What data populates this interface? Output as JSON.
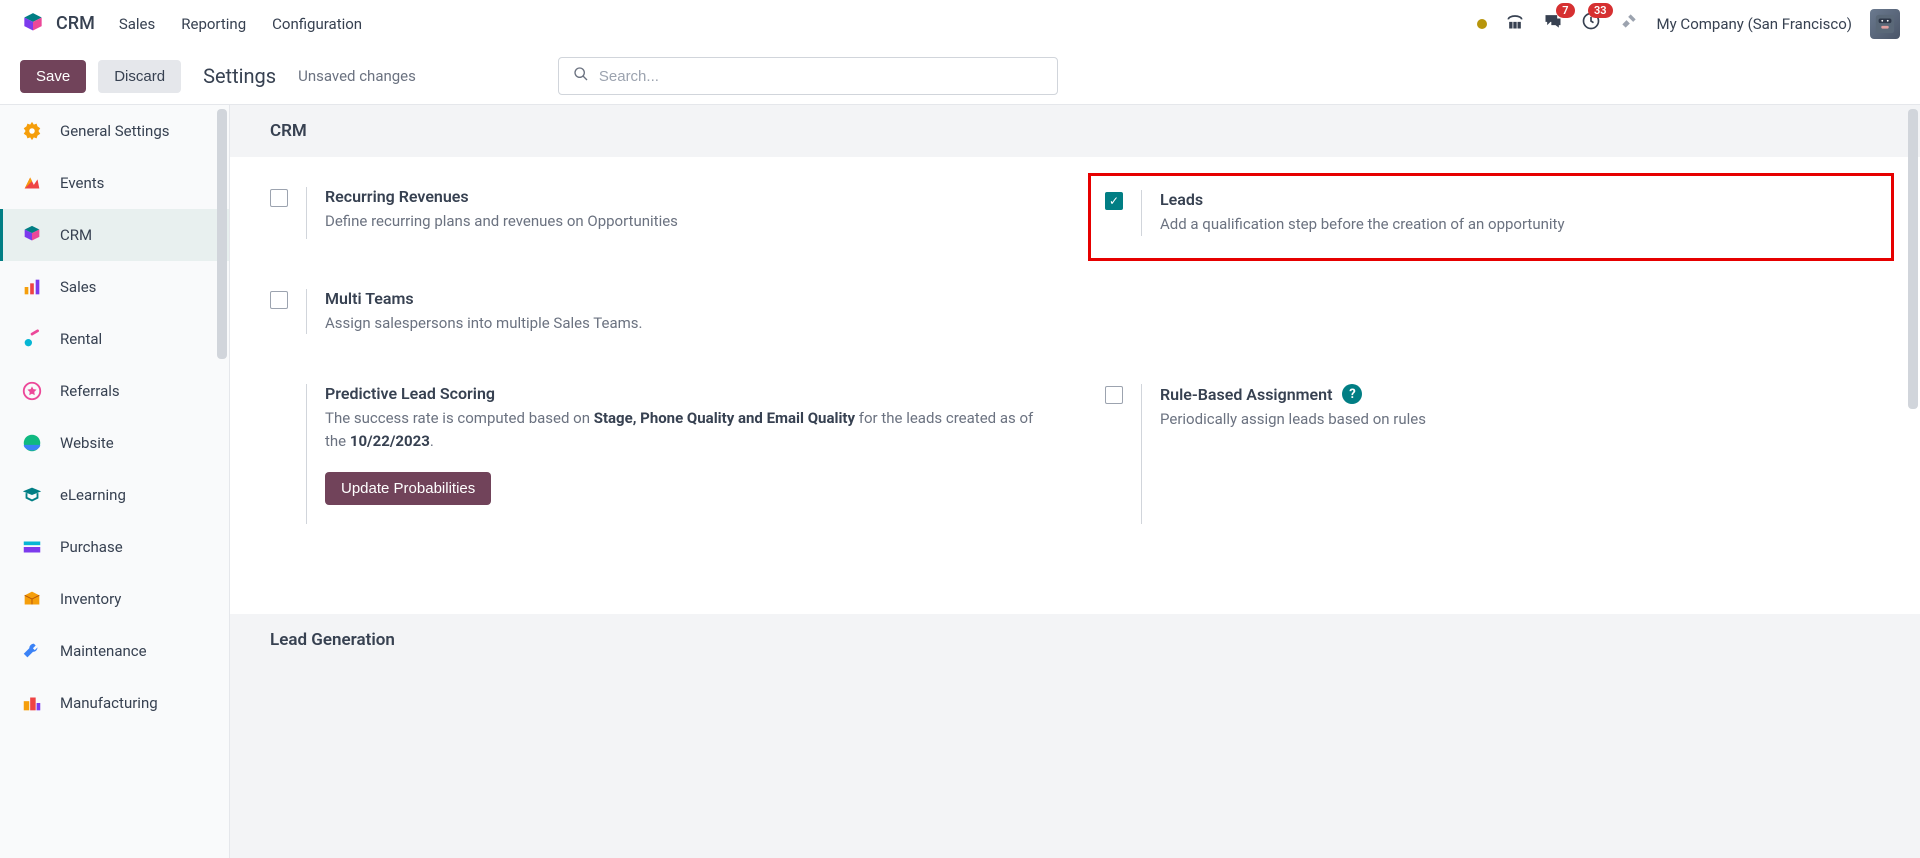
{
  "header": {
    "app": "CRM",
    "nav": [
      "Sales",
      "Reporting",
      "Configuration"
    ],
    "badges": {
      "messages": "7",
      "activities": "33"
    },
    "company": "My Company (San Francisco)"
  },
  "actionbar": {
    "save": "Save",
    "discard": "Discard",
    "title": "Settings",
    "status": "Unsaved changes",
    "search_placeholder": "Search..."
  },
  "sidebar": {
    "items": [
      {
        "label": "General Settings",
        "icon": "gear"
      },
      {
        "label": "Events",
        "icon": "events"
      },
      {
        "label": "CRM",
        "icon": "crm",
        "active": true
      },
      {
        "label": "Sales",
        "icon": "sales"
      },
      {
        "label": "Rental",
        "icon": "rental"
      },
      {
        "label": "Referrals",
        "icon": "referrals"
      },
      {
        "label": "Website",
        "icon": "website"
      },
      {
        "label": "eLearning",
        "icon": "elearning"
      },
      {
        "label": "Purchase",
        "icon": "purchase"
      },
      {
        "label": "Inventory",
        "icon": "inventory"
      },
      {
        "label": "Maintenance",
        "icon": "maintenance"
      },
      {
        "label": "Manufacturing",
        "icon": "manufacturing"
      }
    ]
  },
  "content": {
    "section1_title": "CRM",
    "recurring": {
      "title": "Recurring Revenues",
      "desc": "Define recurring plans and revenues on Opportunities",
      "checked": false
    },
    "leads": {
      "title": "Leads",
      "desc": "Add a qualification step before the creation of an opportunity",
      "checked": true
    },
    "multiteams": {
      "title": "Multi Teams",
      "desc": "Assign salespersons into multiple Sales Teams.",
      "checked": false
    },
    "predictive": {
      "title": "Predictive Lead Scoring",
      "desc_pre": "The success rate is computed based on ",
      "desc_bold": "Stage, Phone Quality and Email Quality",
      "desc_mid": " for the leads created as of the ",
      "desc_date": "10/22/2023",
      "desc_post": ".",
      "button": "Update Probabilities"
    },
    "rulebased": {
      "title": "Rule-Based Assignment",
      "desc": "Periodically assign leads based on rules",
      "checked": false
    },
    "section2_title": "Lead Generation"
  }
}
